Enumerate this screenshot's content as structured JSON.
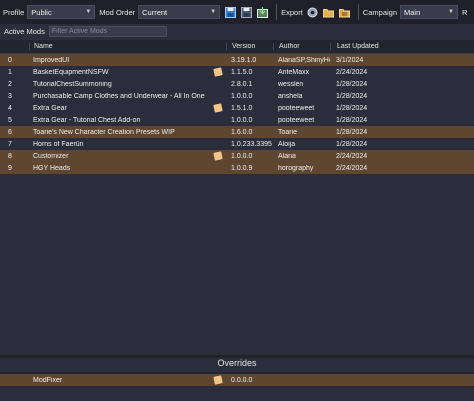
{
  "toolbar": {
    "profile_label": "Profile",
    "profile_value": "Public",
    "mod_order_label": "Mod Order",
    "mod_order_value": "Current",
    "export_label": "Export",
    "campaign_label": "Campaign",
    "campaign_value": "Main",
    "trailing_label": "R"
  },
  "filter": {
    "label": "Active Mods",
    "placeholder": "Filter Active Mods"
  },
  "columns": {
    "index": "",
    "name": "Name",
    "version": "Version",
    "author": "Author",
    "updated": "Last Updated"
  },
  "mods": [
    {
      "index": "0",
      "name": "ImprovedUI",
      "version": "3.19.1.0",
      "author": "AlanaSP,ShinyHc",
      "updated": "3/1/2024",
      "note": false,
      "style": "brown"
    },
    {
      "index": "1",
      "name": "BasketEquipmentNSFW",
      "version": "1.1.5.0",
      "author": "AnteMaxx",
      "updated": "2/24/2024",
      "note": true,
      "style": "dark"
    },
    {
      "index": "2",
      "name": "TutorialChestSummoning",
      "version": "2.8.0.1",
      "author": "wesslen",
      "updated": "1/28/2024",
      "note": false,
      "style": "dark"
    },
    {
      "index": "3",
      "name": "Purchasable Camp Clothes and Underwear - All In One",
      "version": "1.0.0.0",
      "author": "anshela",
      "updated": "1/28/2024",
      "note": false,
      "style": "dark"
    },
    {
      "index": "4",
      "name": "Extra Gear",
      "version": "1.5.1.0",
      "author": "pooteeweet",
      "updated": "1/28/2024",
      "note": true,
      "style": "dark"
    },
    {
      "index": "5",
      "name": "Extra Gear - Tutorial Chest Add-on",
      "version": "1.0.0.0",
      "author": "pooteeweet",
      "updated": "1/28/2024",
      "note": false,
      "style": "dark"
    },
    {
      "index": "6",
      "name": "Toarie's New Character Creation Presets WIP",
      "version": "1.6.0.0",
      "author": "Toarie",
      "updated": "1/28/2024",
      "note": false,
      "style": "brown"
    },
    {
      "index": "7",
      "name": "Horns of Faerûn",
      "version": "1.0.233.3395",
      "author": "Aloija",
      "updated": "1/28/2024",
      "note": false,
      "style": "dark"
    },
    {
      "index": "8",
      "name": "Customizer",
      "version": "1.0.0.0",
      "author": "Alana",
      "updated": "2/24/2024",
      "note": true,
      "style": "brown"
    },
    {
      "index": "9",
      "name": "HGY Heads",
      "version": "1.0.0.9",
      "author": "horography",
      "updated": "2/24/2024",
      "note": false,
      "style": "brown"
    }
  ],
  "overrides": {
    "title": "Overrides",
    "items": [
      {
        "name": "ModFixer",
        "version": "0.0.0.0",
        "note": true
      }
    ]
  },
  "colors": {
    "row_highlight": "#5e4630",
    "background": "#2b2d3a",
    "toolbar": "#1f2029"
  }
}
